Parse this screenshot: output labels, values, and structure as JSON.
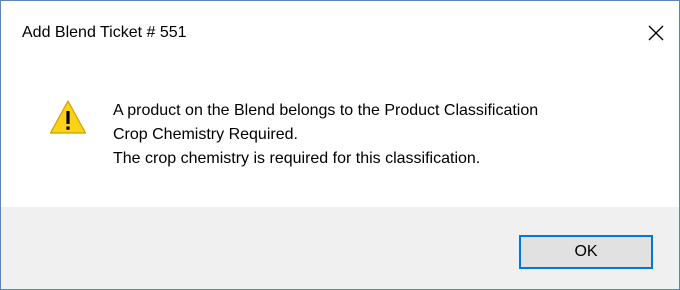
{
  "window": {
    "title": "Add Blend Ticket # 551",
    "close_icon": "close-x-icon"
  },
  "message": {
    "icon": "warning-icon",
    "lines": [
      "A product on the Blend belongs to the Product Classification",
      "Crop Chemistry Required.",
      "The crop chemistry is required for this classification."
    ]
  },
  "buttons": {
    "ok_label": "OK"
  },
  "colors": {
    "accent": "#0078d7",
    "warning_fill": "#fcd116",
    "footer_bg": "#f0f0f0",
    "window_border": "#5b86b3"
  }
}
